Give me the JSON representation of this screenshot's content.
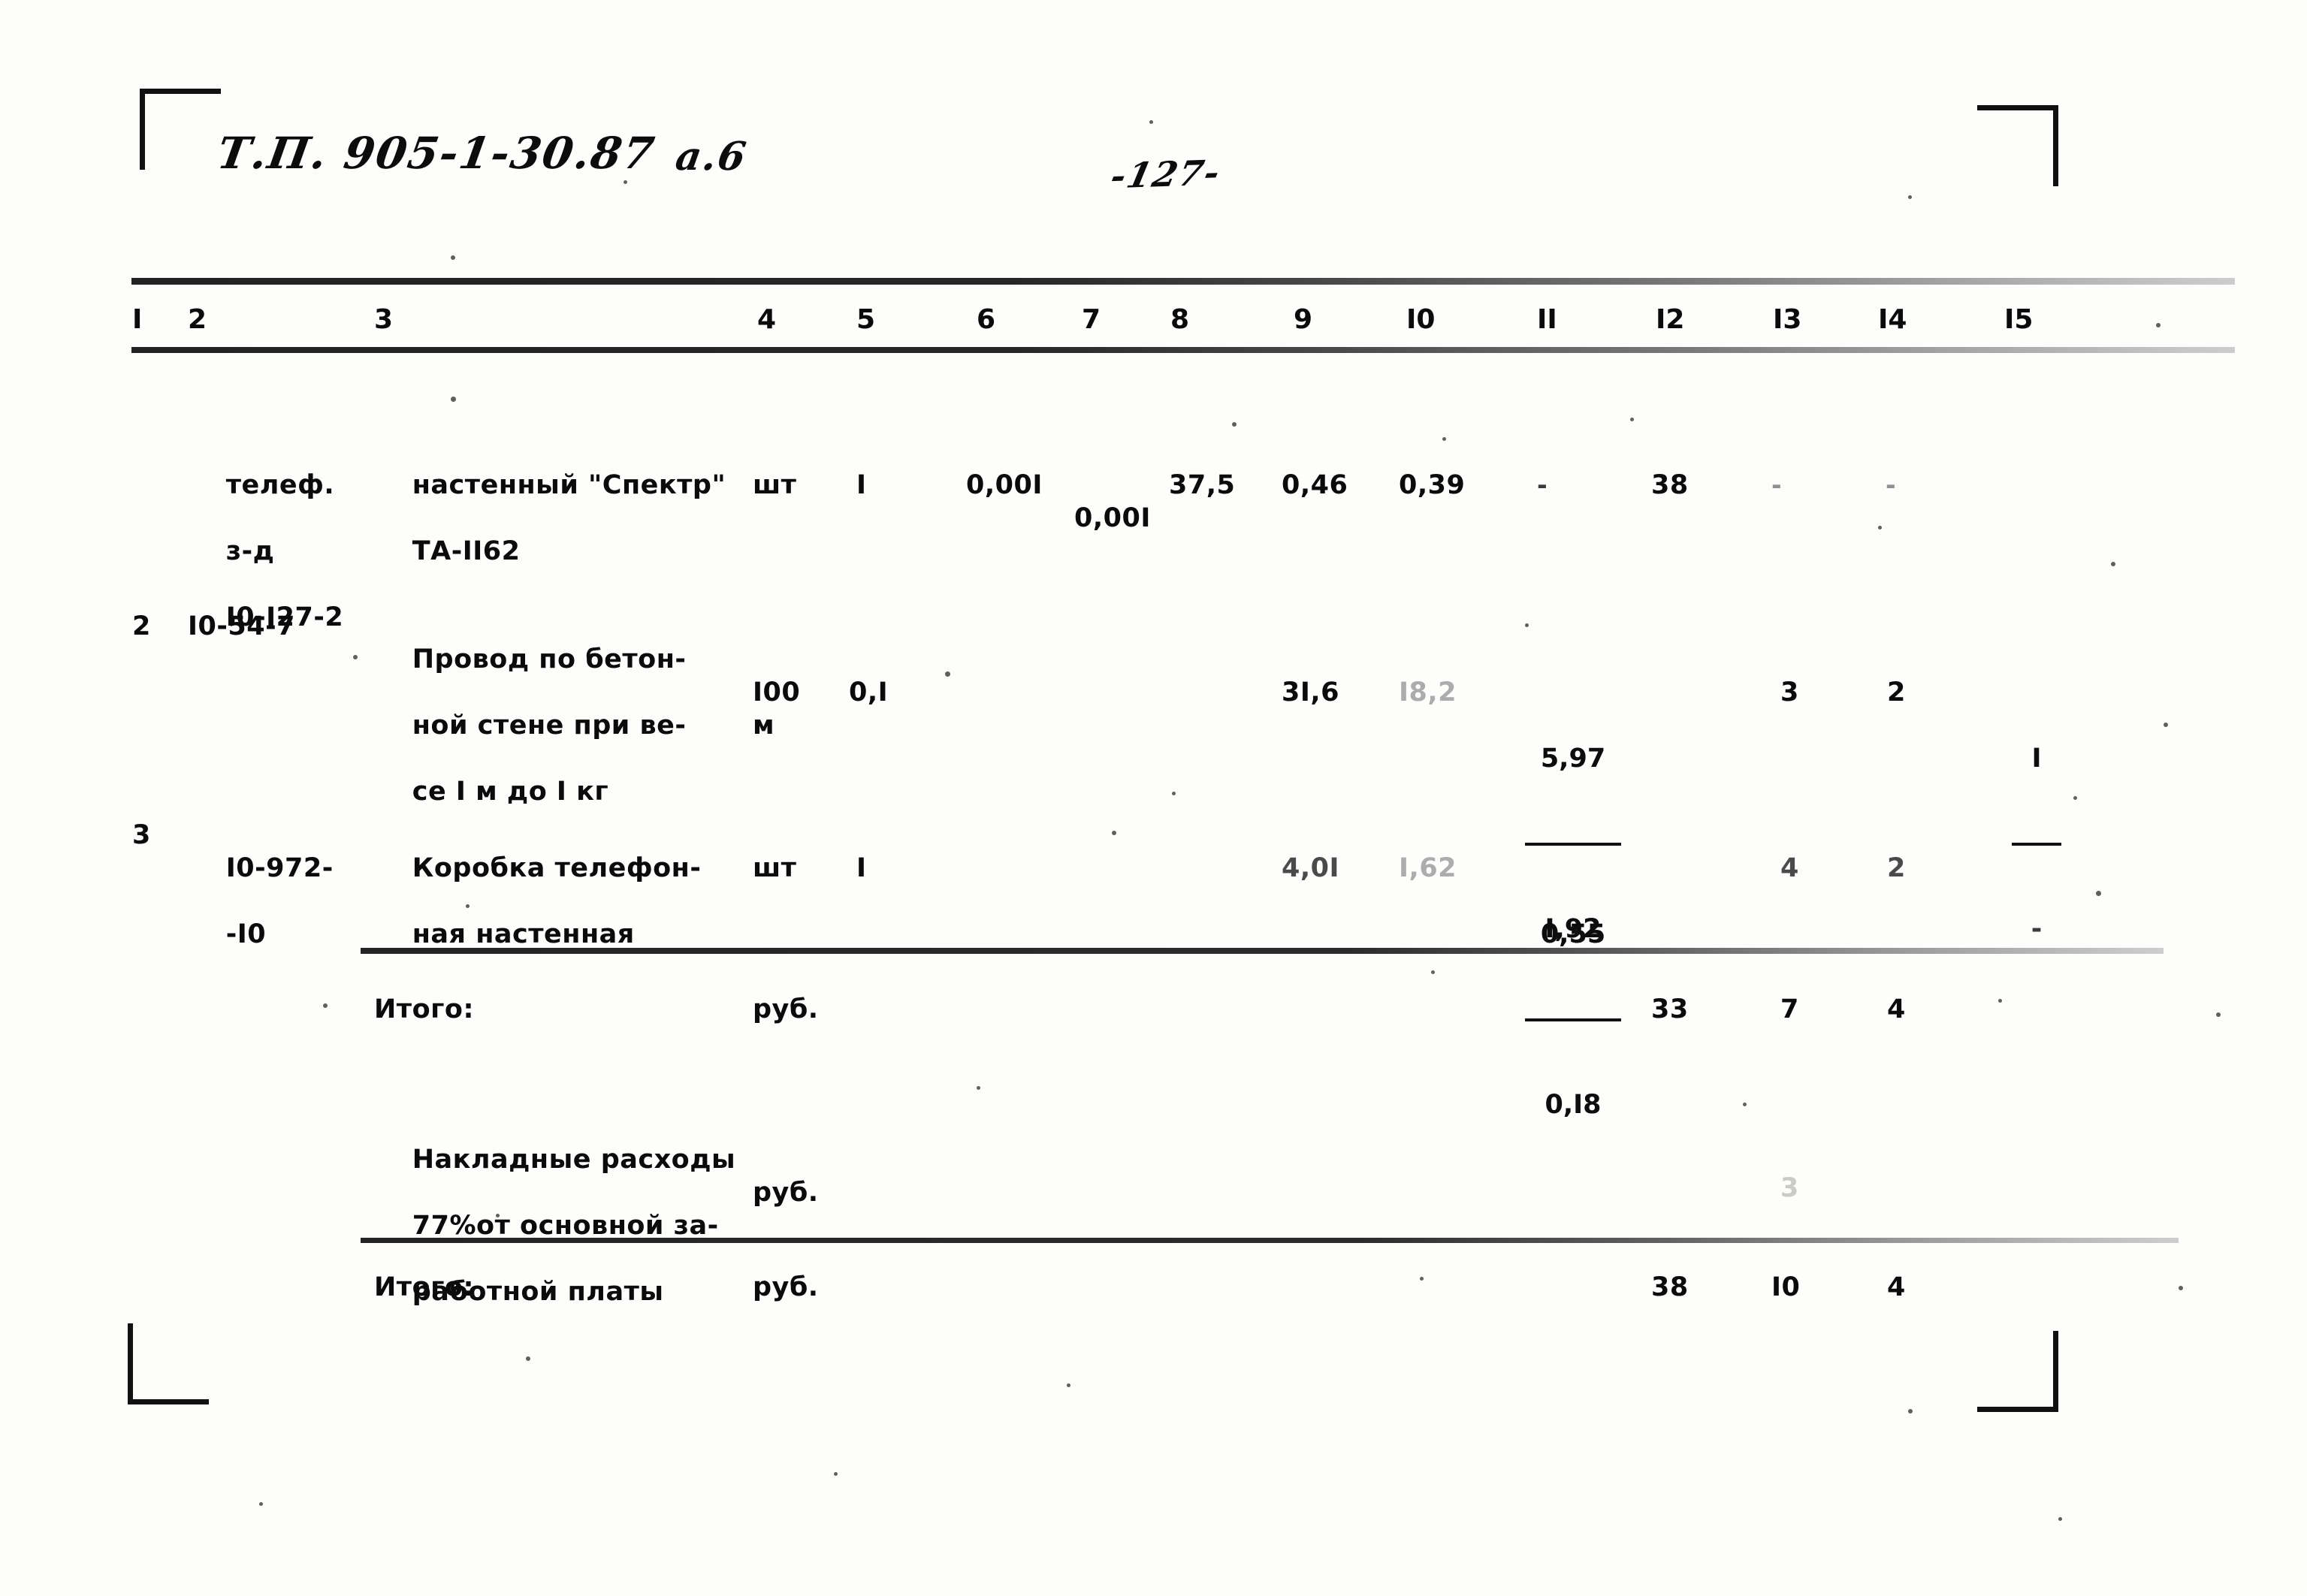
{
  "document": {
    "handwritten_code": "Т.П. 905-1-30.87",
    "handwritten_sheet": "а.6",
    "page_number": "-127-"
  },
  "table": {
    "column_headers": [
      "I",
      "2",
      "3",
      "4",
      "5",
      "6",
      "7",
      "8",
      "9",
      "I0",
      "II",
      "I2",
      "I3",
      "I4",
      "I5"
    ],
    "rows": [
      {
        "num": "",
        "code_lines": [
          "телеф.",
          "з-д",
          "I0-I27-2"
        ],
        "name_lines": [
          "настенный \"Спектр\"",
          "ТА-II62"
        ],
        "unit": "шт",
        "qty": "I",
        "c6": "0,00I",
        "c7": "0,00I",
        "c8": "37,5",
        "c9": "0,46",
        "c10": "0,39",
        "c11": "-",
        "c12": "38",
        "c13": "-",
        "c14": "-",
        "c15": ""
      },
      {
        "num": "2",
        "code_lines": [
          "I0-54-7"
        ],
        "name_lines": [
          "Провод по бетон-",
          "ной стене при ве-",
          "се I м до I кг"
        ],
        "unit": "I00",
        "unit2": "м",
        "qty": "0,I",
        "c9": "3I,6",
        "c10": "I8,2",
        "c11_num": "5,97",
        "c11_den": "I,92",
        "c13": "3",
        "c14": "2",
        "c15_num": "I",
        "c15_den": "-"
      },
      {
        "num": "3",
        "code_lines": [
          "I0-972-",
          "-I0"
        ],
        "name_lines": [
          "Коробка телефон-",
          "ная настенная"
        ],
        "unit": "шт",
        "qty": "I",
        "c9": "4,0I",
        "c10": "I,62",
        "c11_num": "0,55",
        "c11_den": "0,I8",
        "c13": "4",
        "c14": "2"
      }
    ],
    "summary": [
      {
        "label_lines": [
          "Итого:"
        ],
        "unit": "руб.",
        "c12": "33",
        "c13": "7",
        "c14": "4"
      },
      {
        "label_lines": [
          "Накладные расходы",
          "77%от основной за-",
          "работной платы"
        ],
        "unit": "руб.",
        "c13": "3"
      },
      {
        "label_lines": [
          "Итого:"
        ],
        "unit": "руб.",
        "c12": "38",
        "c13": "I0",
        "c14": "4"
      }
    ]
  }
}
